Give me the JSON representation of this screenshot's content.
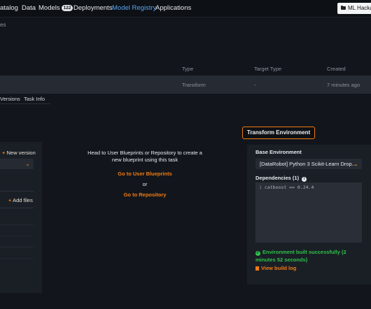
{
  "nav": {
    "items": [
      "atalog",
      "Data",
      "Models",
      "Deployments",
      "Model Registry",
      "Applications"
    ],
    "models_count": "122",
    "workspace": "ML Hacka"
  },
  "breadcrumb": "es",
  "table": {
    "headers": [
      "Type",
      "Target Type",
      "Created"
    ],
    "row": {
      "type": "Transform",
      "target_type": "-",
      "created": "7 minutes ago"
    }
  },
  "tabs": [
    "Versions",
    "Task Info"
  ],
  "left_panel": {
    "new_version": "New version",
    "add_files": "Add files"
  },
  "center": {
    "message": "Head to User Blueprints or Repository to create a new blueprint using this task",
    "go_user_blueprints": "Go to User Blueprints",
    "or": "or",
    "go_repository": "Go to Repository"
  },
  "right_panel": {
    "button": "Transform Environment",
    "base_env_label": "Base Environment",
    "base_env_value": "[DataRobot] Python 3 Scikit-Learn Drop...",
    "dependencies_label": "Dependencies (1)",
    "dependency_line_number": "1",
    "dependency_line": "catboost == 0.24.4",
    "success_message": "Environment built successfully (2 minutes 52 seconds)",
    "build_log": "View build log"
  },
  "colors": {
    "accent": "#f27b13",
    "link_blue": "#5ba3f0",
    "success": "#2fc34a"
  }
}
